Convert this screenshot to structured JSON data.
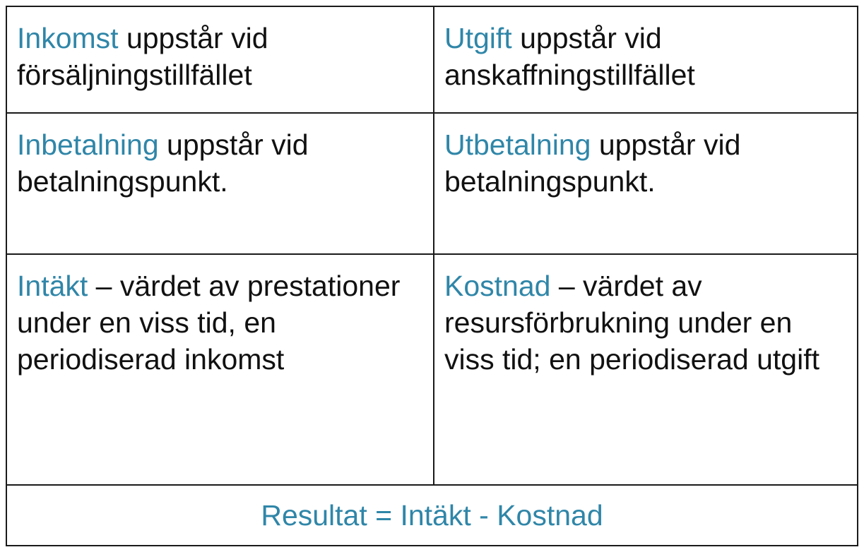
{
  "colors": {
    "term": "#2f86a8",
    "text": "#111111",
    "border": "#1a1a1a"
  },
  "cells": [
    {
      "term": "Inkomst",
      "rest": " uppstår vid försäljningstillfället"
    },
    {
      "term": "Utgift",
      "rest": " uppstår vid anskaffningstillfället"
    },
    {
      "term": "Inbetalning",
      "rest": " uppstår vid betalningspunkt."
    },
    {
      "term": "Utbetalning",
      "rest": " uppstår vid betalningspunkt."
    },
    {
      "term": "Intäkt",
      "rest": " – värdet av prestationer under en viss tid, en periodiserad inkomst"
    },
    {
      "term": "Kostnad",
      "rest": " – värdet av resursförbrukning under en viss tid; en periodiserad utgift"
    }
  ],
  "footer": {
    "formula": "Resultat = Intäkt - Kostnad"
  }
}
